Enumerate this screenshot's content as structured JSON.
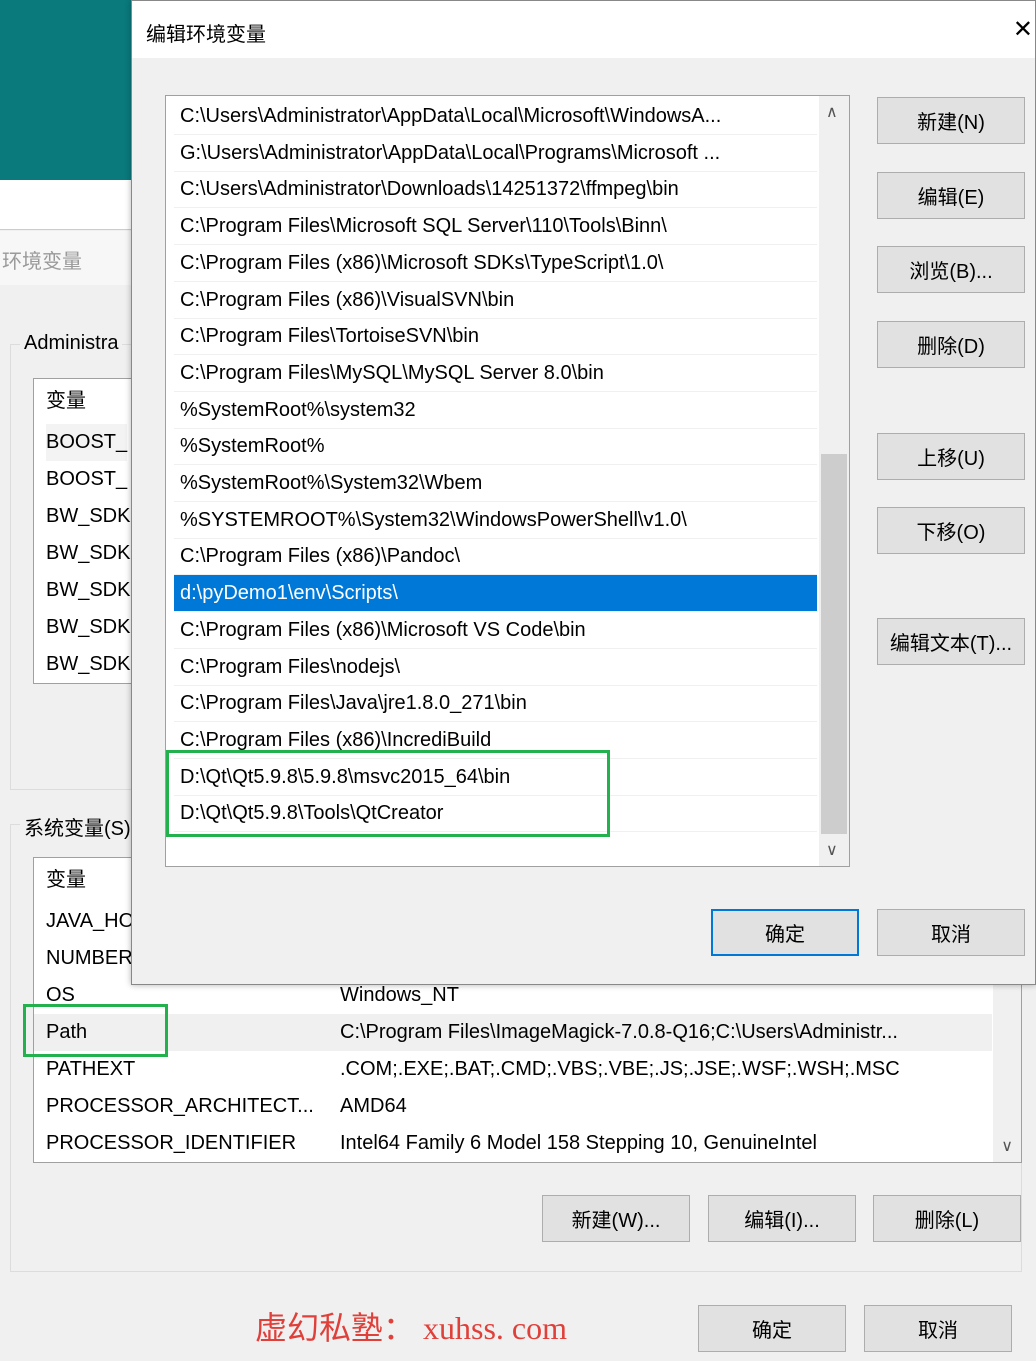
{
  "background_window": {
    "tab_label": "环境变量",
    "user_group_label": "Administra",
    "user_vars": {
      "header": "变量",
      "rows": [
        "BOOST_",
        "BOOST_",
        "BW_SDK",
        "BW_SDK",
        "BW_SDK",
        "BW_SDK",
        "BW_SDK"
      ]
    },
    "system_group_label": "系统变量(S)",
    "system_vars": {
      "header": "变量",
      "rows": [
        {
          "name": "JAVA_HO",
          "value": ""
        },
        {
          "name": "NUMBER",
          "value": ""
        },
        {
          "name": "OS",
          "value": "Windows_NT"
        },
        {
          "name": "Path",
          "value": "C:\\Program Files\\ImageMagick-7.0.8-Q16;C:\\Users\\Administr..."
        },
        {
          "name": "PATHEXT",
          "value": ".COM;.EXE;.BAT;.CMD;.VBS;.VBE;.JS;.JSE;.WSF;.WSH;.MSC"
        },
        {
          "name": "PROCESSOR_ARCHITECT...",
          "value": "AMD64"
        },
        {
          "name": "PROCESSOR_IDENTIFIER",
          "value": "Intel64 Family 6 Model 158 Stepping 10, GenuineIntel"
        }
      ]
    },
    "buttons": {
      "new": "新建(W)...",
      "edit": "编辑(I)...",
      "delete": "删除(L)",
      "ok": "确定",
      "cancel": "取消"
    },
    "highlight_color": "#22b14c"
  },
  "dialog": {
    "title": "编辑环境变量",
    "close": "✕",
    "entries": [
      "C:\\Users\\Administrator\\AppData\\Local\\Microsoft\\WindowsA...",
      "G:\\Users\\Administrator\\AppData\\Local\\Programs\\Microsoft ...",
      "C:\\Users\\Administrator\\Downloads\\14251372\\ffmpeg\\bin",
      "C:\\Program Files\\Microsoft SQL Server\\110\\Tools\\Binn\\",
      "C:\\Program Files (x86)\\Microsoft SDKs\\TypeScript\\1.0\\",
      "C:\\Program Files (x86)\\VisualSVN\\bin",
      "C:\\Program Files\\TortoiseSVN\\bin",
      "C:\\Program Files\\MySQL\\MySQL Server 8.0\\bin",
      "%SystemRoot%\\system32",
      "%SystemRoot%",
      "%SystemRoot%\\System32\\Wbem",
      "%SYSTEMROOT%\\System32\\WindowsPowerShell\\v1.0\\",
      "C:\\Program Files (x86)\\Pandoc\\",
      "d:\\pyDemo1\\env\\Scripts\\",
      "C:\\Program Files (x86)\\Microsoft VS Code\\bin",
      "C:\\Program Files\\nodejs\\",
      "C:\\Program Files\\Java\\jre1.8.0_271\\bin",
      "C:\\Program Files (x86)\\IncrediBuild",
      "D:\\Qt\\Qt5.9.8\\5.9.8\\msvc2015_64\\bin",
      "D:\\Qt\\Qt5.9.8\\Tools\\QtCreator"
    ],
    "selected_index": 13,
    "buttons": {
      "new": "新建(N)",
      "edit": "编辑(E)",
      "browse": "浏览(B)...",
      "delete": "删除(D)",
      "up": "上移(U)",
      "down": "下移(O)",
      "edit_text": "编辑文本(T)...",
      "ok": "确定",
      "cancel": "取消"
    },
    "selection_color": "#0078d7"
  },
  "watermark": "虚幻私塾： xuhss. com"
}
